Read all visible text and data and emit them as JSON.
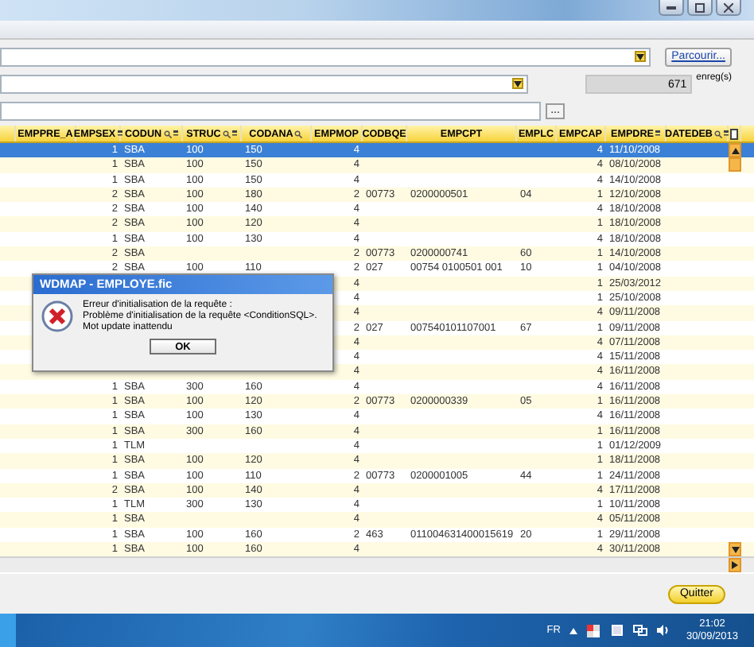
{
  "form": {
    "browse_button": "Parcourir...",
    "count": "671",
    "count_unit": "enreg(s)",
    "ellipsis_button": "..."
  },
  "table": {
    "columns": [
      {
        "label": "EMPPRE_A",
        "sort": false,
        "filter": false
      },
      {
        "label": "EMPSEX",
        "sort": true,
        "filter": false
      },
      {
        "label": "CODUN",
        "sort": true,
        "filter": true
      },
      {
        "label": "STRUC",
        "sort": true,
        "filter": true
      },
      {
        "label": "CODANA",
        "sort": false,
        "filter": true
      },
      {
        "label": "EMPMOP",
        "sort": false,
        "filter": false
      },
      {
        "label": "CODBQE",
        "sort": false,
        "filter": false
      },
      {
        "label": "EMPCPT",
        "sort": false,
        "filter": false
      },
      {
        "label": "EMPLC",
        "sort": false,
        "filter": false
      },
      {
        "label": "EMPCAP",
        "sort": false,
        "filter": false
      },
      {
        "label": "EMPDRE",
        "sort": true,
        "filter": false
      },
      {
        "label": "DATEDEB",
        "sort": true,
        "filter": true
      }
    ],
    "rows": [
      {
        "selected": true,
        "empsex": "1",
        "coduni": "SBA",
        "struc": "100",
        "codana": "150",
        "empmop": "4",
        "empcap": "4",
        "empdre": "11/10/2008"
      },
      {
        "selected": false,
        "empsex": "1",
        "coduni": "SBA",
        "struc": "100",
        "codana": "150",
        "empmop": "4",
        "empcap": "4",
        "empdre": "08/10/2008"
      },
      {
        "selected": false,
        "empsex": "1",
        "coduni": "SBA",
        "struc": "100",
        "codana": "150",
        "empmop": "4",
        "empcap": "4",
        "empdre": "14/10/2008"
      },
      {
        "selected": false,
        "empsex": "2",
        "coduni": "SBA",
        "struc": "100",
        "codana": "180",
        "empmop": "2",
        "codbqe": "00773",
        "empcpt": "0200000501",
        "emplc": "04",
        "empcap": "1",
        "empdre": "12/10/2008"
      },
      {
        "selected": false,
        "empsex": "2",
        "coduni": "SBA",
        "struc": "100",
        "codana": "140",
        "empmop": "4",
        "empcap": "4",
        "empdre": "18/10/2008"
      },
      {
        "selected": false,
        "empsex": "2",
        "coduni": "SBA",
        "struc": "100",
        "codana": "120",
        "empmop": "4",
        "empcap": "1",
        "empdre": "18/10/2008"
      },
      {
        "selected": false,
        "empsex": "1",
        "coduni": "SBA",
        "struc": "100",
        "codana": "130",
        "empmop": "4",
        "empcap": "4",
        "empdre": "18/10/2008"
      },
      {
        "selected": false,
        "empsex": "2",
        "coduni": "SBA",
        "empmop": "2",
        "codbqe": "00773",
        "empcpt": "0200000741",
        "emplc": "60",
        "empcap": "1",
        "empdre": "14/10/2008"
      },
      {
        "selected": false,
        "empsex": "2",
        "coduni": "SBA",
        "struc": "100",
        "codana": "110",
        "empmop": "2",
        "codbqe": "027",
        "empcpt": "00754 0100501 001",
        "emplc": "10",
        "empcap": "1",
        "empdre": "04/10/2008"
      },
      {
        "selected": false,
        "empmop": "4",
        "empcap": "1",
        "empdre": "25/03/2012"
      },
      {
        "selected": false,
        "empmop": "4",
        "empcap": "1",
        "empdre": "25/10/2008"
      },
      {
        "selected": false,
        "empmop": "4",
        "empcap": "4",
        "empdre": "09/11/2008"
      },
      {
        "selected": false,
        "empmop": "2",
        "codbqe": "027",
        "empcpt": "007540101107001",
        "emplc": "67",
        "empcap": "1",
        "empdre": "09/11/2008"
      },
      {
        "selected": false,
        "empmop": "4",
        "empcap": "4",
        "empdre": "07/11/2008"
      },
      {
        "selected": false,
        "empmop": "4",
        "empcap": "4",
        "empdre": "15/11/2008"
      },
      {
        "selected": false,
        "empmop": "4",
        "empcap": "4",
        "empdre": "16/11/2008"
      },
      {
        "selected": false,
        "empsex": "1",
        "coduni": "SBA",
        "struc": "300",
        "codana": "160",
        "empmop": "4",
        "empcap": "4",
        "empdre": "16/11/2008"
      },
      {
        "selected": false,
        "empsex": "1",
        "coduni": "SBA",
        "struc": "100",
        "codana": "120",
        "empmop": "2",
        "codbqe": "00773",
        "empcpt": "0200000339",
        "emplc": "05",
        "empcap": "1",
        "empdre": "16/11/2008"
      },
      {
        "selected": false,
        "empsex": "1",
        "coduni": "SBA",
        "struc": "100",
        "codana": "130",
        "empmop": "4",
        "empcap": "4",
        "empdre": "16/11/2008"
      },
      {
        "selected": false,
        "empsex": "1",
        "coduni": "SBA",
        "struc": "300",
        "codana": "160",
        "empmop": "4",
        "empcap": "1",
        "empdre": "16/11/2008"
      },
      {
        "selected": false,
        "empsex": "1",
        "coduni": "TLM",
        "empmop": "4",
        "empcap": "1",
        "empdre": "01/12/2009"
      },
      {
        "selected": false,
        "empsex": "1",
        "coduni": "SBA",
        "struc": "100",
        "codana": "120",
        "empmop": "4",
        "empcap": "1",
        "empdre": "18/11/2008"
      },
      {
        "selected": false,
        "empsex": "1",
        "coduni": "SBA",
        "struc": "100",
        "codana": "110",
        "empmop": "2",
        "codbqe": "00773",
        "empcpt": "0200001005",
        "emplc": "44",
        "empcap": "1",
        "empdre": "24/11/2008"
      },
      {
        "selected": false,
        "empsex": "2",
        "coduni": "SBA",
        "struc": "100",
        "codana": "140",
        "empmop": "4",
        "empcap": "4",
        "empdre": "17/11/2008"
      },
      {
        "selected": false,
        "empsex": "1",
        "coduni": "TLM",
        "struc": "300",
        "codana": "130",
        "empmop": "4",
        "empcap": "1",
        "empdre": "10/11/2008"
      },
      {
        "selected": false,
        "empsex": "1",
        "coduni": "SBA",
        "empmop": "4",
        "empcap": "4",
        "empdre": "05/11/2008"
      },
      {
        "selected": false,
        "empsex": "1",
        "coduni": "SBA",
        "struc": "100",
        "codana": "160",
        "empmop": "2",
        "codbqe": "463",
        "empcpt": "011004631400015619",
        "emplc": "20",
        "empcap": "1",
        "empdre": "29/11/2008"
      },
      {
        "selected": false,
        "empsex": "1",
        "coduni": "SBA",
        "struc": "100",
        "codana": "160",
        "empmop": "4",
        "empcap": "4",
        "empdre": "30/11/2008"
      }
    ]
  },
  "dialog": {
    "title": "WDMAP - EMPLOYE.fic",
    "lines": [
      "Erreur d'initialisation de la requête :",
      "Problème d'initialisation de la requête <ConditionSQL>.",
      "Mot update inattendu"
    ],
    "button": "OK"
  },
  "quit_button": "Quitter",
  "taskbar": {
    "language": "FR",
    "time": "21:02",
    "date": "30/09/2013"
  }
}
